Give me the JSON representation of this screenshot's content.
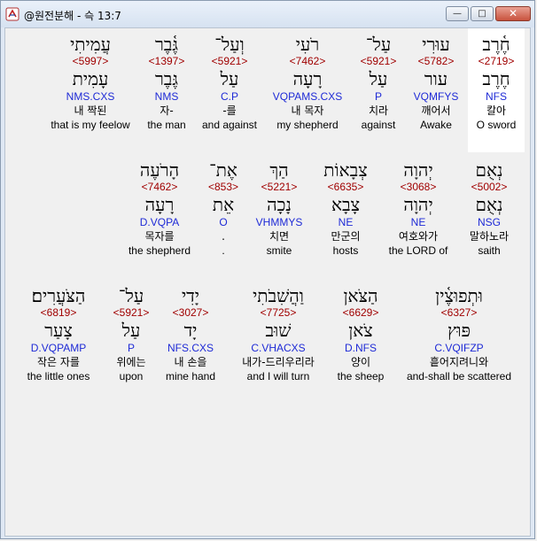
{
  "window": {
    "title": "@원전분해 - 슥 13:7"
  },
  "controls": {
    "minimize": "—",
    "maximize": "□",
    "close": "✕"
  },
  "rows": [
    {
      "words": [
        {
          "heb": "חֶ֫רֶב",
          "strong": "<2719>",
          "lemma": "חֶרֶב",
          "morph": "NFS",
          "kor": "칼아",
          "eng": "O sword"
        },
        {
          "heb": "עוּרִי",
          "strong": "<5782>",
          "lemma": "עור",
          "morph": "VQMFYS",
          "kor": "깨어서",
          "eng": "Awake"
        },
        {
          "heb": "עַל־",
          "strong": "<5921>",
          "lemma": "עַל",
          "morph": "P",
          "kor": "치라",
          "eng": "against"
        },
        {
          "heb": "רֹעִי",
          "strong": "<7462>",
          "lemma": "רָעָה",
          "morph": "VQPAMS.CXS",
          "kor": "내 목자",
          "eng": "my shepherd"
        },
        {
          "heb": "וְעַל־",
          "strong": "<5921>",
          "lemma": "עַל",
          "morph": "C.P",
          "kor": "-를",
          "eng": "and against"
        },
        {
          "heb": "גֶּ֫בֶר",
          "strong": "<1397>",
          "lemma": "גֶּבֶר",
          "morph": "NMS",
          "kor": "자-",
          "eng": "the man"
        },
        {
          "heb": "עֲמִיתִי",
          "strong": "<5997>",
          "lemma": "עָמִית",
          "morph": "NMS.CXS",
          "kor": "내 짝된",
          "eng": "that is my feelow"
        }
      ]
    },
    {
      "words": [
        {
          "heb": "נְאֻם",
          "strong": "<5002>",
          "lemma": "נְאֻם",
          "morph": "NSG",
          "kor": "말하노라",
          "eng": "saith"
        },
        {
          "heb": "יְהוָה",
          "strong": "<3068>",
          "lemma": "יְהוָה",
          "morph": "NE",
          "kor": "여호와가",
          "eng": "the LORD of"
        },
        {
          "heb": "צְבָאוֹת",
          "strong": "<6635>",
          "lemma": "צָבָא",
          "morph": "NE",
          "kor": "만군의",
          "eng": "hosts"
        },
        {
          "heb": "הַךְ",
          "strong": "<5221>",
          "lemma": "נָכָה",
          "morph": "VHMMYS",
          "kor": "치면",
          "eng": "smite"
        },
        {
          "heb": "אֶת־",
          "strong": "<853>",
          "lemma": "אֵת",
          "morph": "O",
          "kor": ".",
          "eng": "."
        },
        {
          "heb": "הָרֹעֶה",
          "strong": "<7462>",
          "lemma": "רָעָה",
          "morph": "D.VQPA",
          "kor": "목자를",
          "eng": "the shepherd"
        }
      ]
    },
    {
      "words": [
        {
          "heb": "וּתְפוּצֶ֫ין",
          "strong": "<6327>",
          "lemma": "פּוּץ",
          "morph": "C.VQIFZP",
          "kor": "흩어지려니와",
          "eng": "and-shall be scattered"
        },
        {
          "heb": "הַצֹּאן",
          "strong": "<6629>",
          "lemma": "צֹאן",
          "morph": "D.NFS",
          "kor": "양이",
          "eng": "the sheep"
        },
        {
          "heb": "וַהֲשִׁבֹתִי",
          "strong": "<7725>",
          "lemma": "שׁוּב",
          "morph": "C.VHACXS",
          "kor": "내가-드리우리라",
          "eng": "and I will turn"
        },
        {
          "heb": "יָדִי",
          "strong": "<3027>",
          "lemma": "יָד",
          "morph": "NFS.CXS",
          "kor": "내 손을",
          "eng": "mine hand"
        },
        {
          "heb": "עַל־",
          "strong": "<5921>",
          "lemma": "עַל",
          "morph": "P",
          "kor": "위에는",
          "eng": "upon"
        },
        {
          "heb": "הַצֹּעֲרִים׃",
          "strong": "<6819>",
          "lemma": "צָעַר",
          "morph": "D.VQPAMP",
          "kor": "작은 자를",
          "eng": "the little ones"
        }
      ]
    }
  ]
}
